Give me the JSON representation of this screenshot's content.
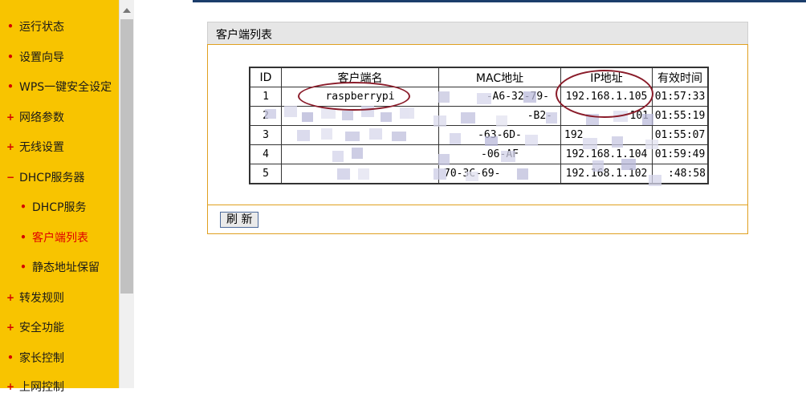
{
  "sidebar": {
    "items": [
      {
        "label": "运行状态",
        "marker": "•",
        "active": false
      },
      {
        "label": "设置向导",
        "marker": "•",
        "active": false
      },
      {
        "label": "WPS一键安全设定",
        "marker": "•",
        "active": false
      },
      {
        "label": "网络参数",
        "marker": "+",
        "active": false
      },
      {
        "label": "无线设置",
        "marker": "+",
        "active": false
      },
      {
        "label": "DHCP服务器",
        "marker": "−",
        "active": false
      },
      {
        "label": "DHCP服务",
        "marker": "•",
        "active": false
      },
      {
        "label": "客户端列表",
        "marker": "•",
        "active": true
      },
      {
        "label": "静态地址保留",
        "marker": "•",
        "active": false
      },
      {
        "label": "转发规则",
        "marker": "+",
        "active": false
      },
      {
        "label": "安全功能",
        "marker": "+",
        "active": false
      },
      {
        "label": "家长控制",
        "marker": "•",
        "active": false
      },
      {
        "label": "上网控制",
        "marker": "+",
        "active": false
      }
    ]
  },
  "panel": {
    "title": "客户端列表",
    "refresh_label": "刷 新"
  },
  "table": {
    "headers": [
      "ID",
      "客户端名",
      "MAC地址",
      "IP地址",
      "有效时间"
    ],
    "rows": [
      [
        "1",
        "raspberrypi",
        "-A6-32-79-",
        "192.168.1.105",
        "01:57:33"
      ],
      [
        "2",
        "",
        "-B2-",
        "101",
        "01:55:19"
      ],
      [
        "3",
        "",
        "-63-6D-",
        "192",
        "01:55:07"
      ],
      [
        "4",
        "",
        "-06-AF",
        "192.168.1.104",
        "01:59:49"
      ],
      [
        "5",
        "",
        "70-3C-69-",
        "192.168.1.102",
        ":48:58"
      ]
    ]
  },
  "colors": {
    "sidebar_bg": "#f8c400",
    "active_item": "#e00000",
    "annotation": "#8a1c2a",
    "panel_border": "#e0a020"
  }
}
